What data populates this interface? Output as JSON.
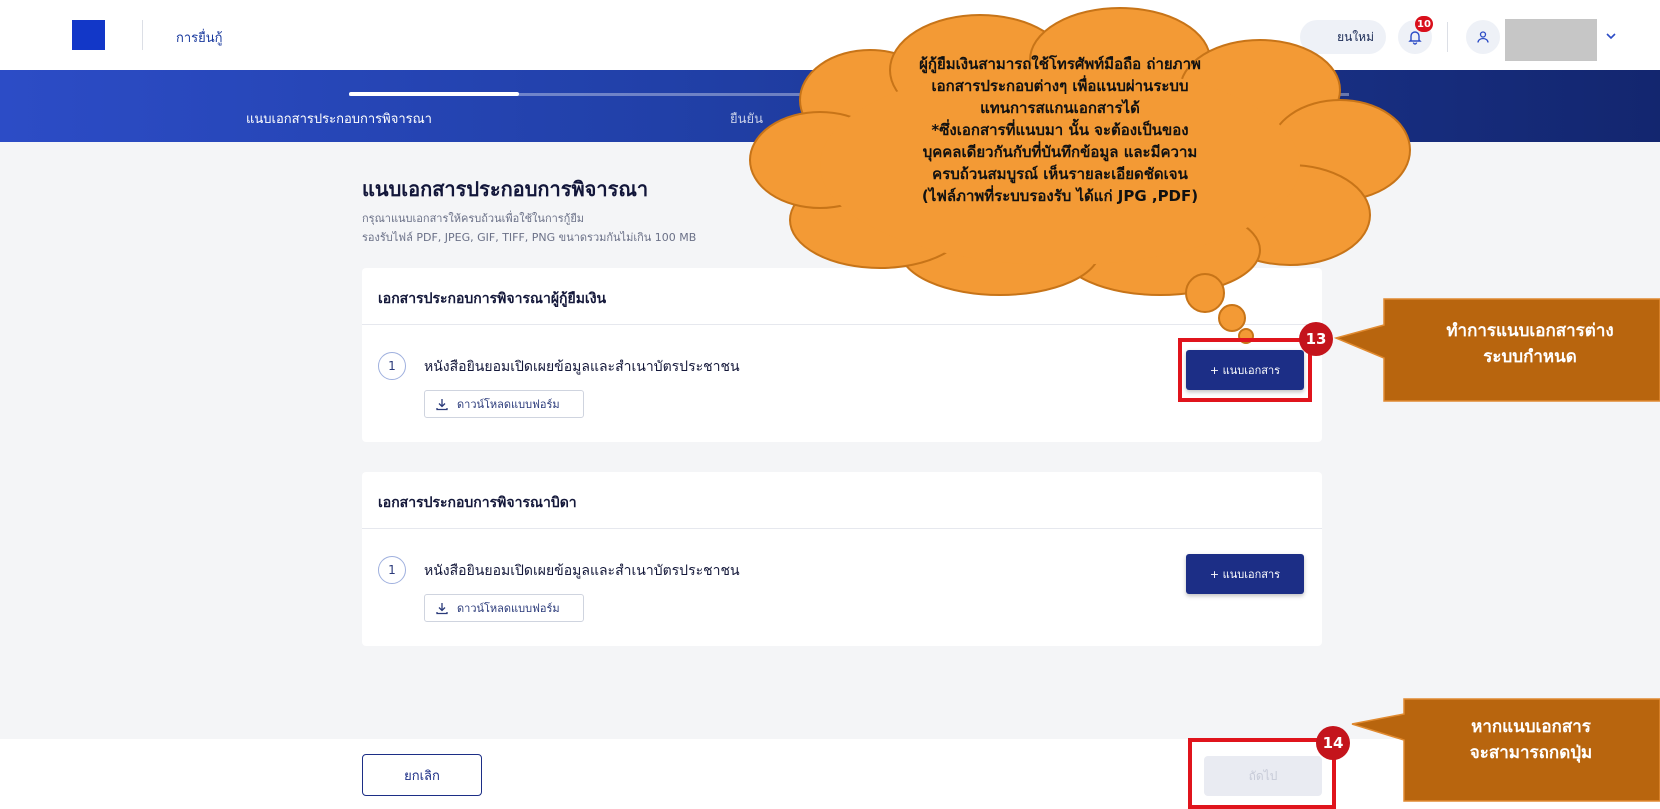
{
  "nav": {
    "title": "การยื่นกู้",
    "new_label": "ยนใหม่",
    "notification_count": "10"
  },
  "steps": {
    "step1_label": "แนบเอกสารประกอบการพิจารณา",
    "step2_label": "ยืนยัน"
  },
  "main": {
    "title": "แนบเอกสารประกอบการพิจารณา",
    "hint1": "กรุณาแนบเอกสารให้ครบถ้วนเพื่อใช้ในการกู้ยืม",
    "hint2": "รองรับไฟล์ PDF, JPEG, GIF, TIFF, PNG ขนาดรวมกันไม่เกิน 100 MB"
  },
  "sections": [
    {
      "heading": "เอกสารประกอบการพิจารณาผู้กู้ยืมเงิน",
      "item_number": "1",
      "item_label": "หนังสือยินยอมเปิดเผยข้อมูลและสำเนาบัตรประชาชน",
      "download_label": "ดาวน์โหลดแบบฟอร์ม",
      "attach_label": "+ แนบเอกสาร"
    },
    {
      "heading": "เอกสารประกอบการพิจารณาบิดา",
      "item_number": "1",
      "item_label": "หนังสือยินยอมเปิดเผยข้อมูลและสำเนาบัตรประชาชน",
      "download_label": "ดาวน์โหลดแบบฟอร์ม",
      "attach_label": "+ แนบเอกสาร"
    }
  ],
  "footer": {
    "cancel_label": "ยกเลิก",
    "next_label": "ถัดไป"
  },
  "annotations": {
    "badge13": "13",
    "badge14": "14",
    "callout13_line1": "ทำการแนบเอกสารต่าง",
    "callout13_line2": "ระบบกำหนด",
    "callout14_line1": "หากแนบเอกสาร",
    "callout14_line2": "จะสามารถกดปุ่ม",
    "cloud_line1": "ผู้กู้ยืมเงินสามารถใช้โทรศัพท์มือถือ ถ่ายภาพ",
    "cloud_line2": "เอกสารประกอบต่างๆ เพื่อแนบผ่านระบบ",
    "cloud_line3": "แทนการสแกนเอกสารได้",
    "cloud_line4": "*ซึ่งเอกสารที่แนบมา นั้น จะต้องเป็นของ",
    "cloud_line5": "บุคคลเดียวกันกับที่บันทึกข้อมูล และมีความ",
    "cloud_line6": "ครบถ้วนสมบูรณ์ เห็นรายละเอียดชัดเจน",
    "cloud_line7": "(ไฟล์ภาพที่ระบบรองรับ ได้แก่ JPG ,PDF)"
  },
  "colors": {
    "primary": "#1c2e86",
    "highlight_red": "#e0141c",
    "callout_brown": "#b8650e",
    "cloud_orange": "#f39a35"
  }
}
